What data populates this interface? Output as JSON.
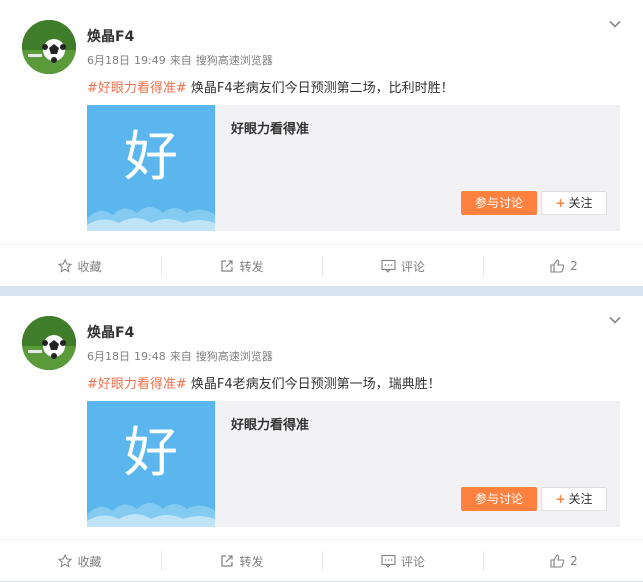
{
  "posts": [
    {
      "user_name": "焕晶F4",
      "date": "6月18日",
      "time": "19:49",
      "source_prefix": "来自",
      "source": "搜狗高速浏览器",
      "topic": "#好眼力看得准#",
      "text": " 焕晶F4老病友们今日预测第二场，比利时胜！",
      "card": {
        "thumb_char": "好",
        "title": "好眼力看得准",
        "discuss_label": "参与讨论",
        "follow_label": "关注"
      },
      "actions": {
        "favorite": "收藏",
        "repost": "转发",
        "comment": "评论",
        "like_count": "2"
      }
    },
    {
      "user_name": "焕晶F4",
      "date": "6月18日",
      "time": "19:48",
      "source_prefix": "来自",
      "source": "搜狗高速浏览器",
      "topic": "#好眼力看得准#",
      "text": " 焕晶F4老病友们今日预测第一场，瑞典胜！",
      "card": {
        "thumb_char": "好",
        "title": "好眼力看得准",
        "discuss_label": "参与讨论",
        "follow_label": "关注"
      },
      "actions": {
        "favorite": "收藏",
        "repost": "转发",
        "comment": "评论",
        "like_count": "2"
      }
    }
  ],
  "colors": {
    "topic": "#eb7350",
    "discuss_button": "#ff8140",
    "card_thumb": "#5ab6ec",
    "page_background": "#d7e4ef"
  },
  "icons": [
    "chevron-down-icon",
    "star-icon",
    "repost-icon",
    "comment-icon",
    "like-icon"
  ]
}
